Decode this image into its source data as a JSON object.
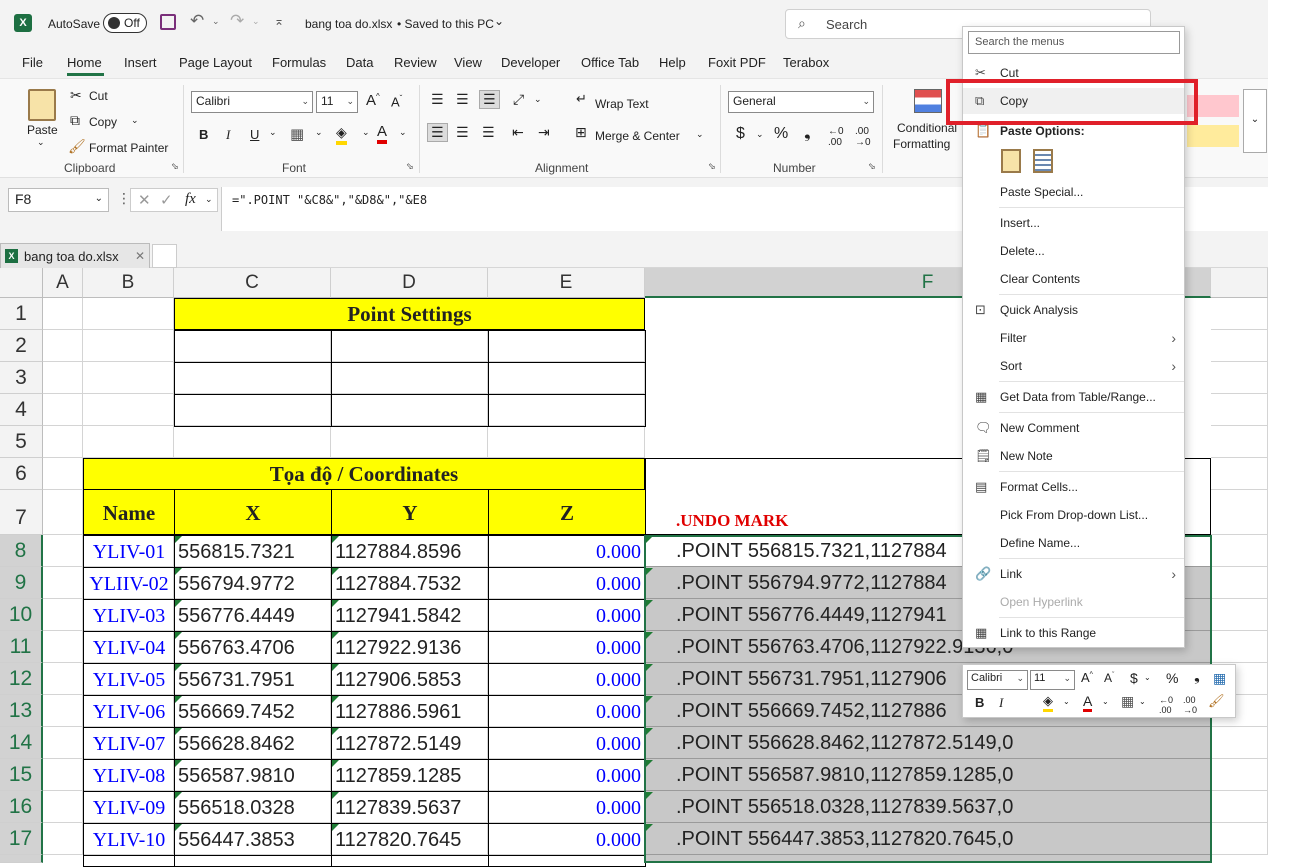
{
  "titlebar": {
    "autosave_label": "AutoSave",
    "toggle_state": "Off",
    "filename": "bang toa do.xlsx",
    "saved_status": "• Saved to this PC",
    "search_placeholder": "Search"
  },
  "menu_tabs": [
    "File",
    "Home",
    "Insert",
    "Page Layout",
    "Formulas",
    "Data",
    "Review",
    "View",
    "Developer",
    "Office Tab",
    "Help",
    "Foxit PDF",
    "Terabox"
  ],
  "ribbon": {
    "clipboard": {
      "paste": "Paste",
      "cut": "Cut",
      "copy": "Copy",
      "format_painter": "Format Painter",
      "label": "Clipboard"
    },
    "font": {
      "name": "Calibri",
      "size": "11",
      "label": "Font",
      "bold": "B",
      "italic": "I",
      "underline": "U"
    },
    "alignment": {
      "wrap": "Wrap Text",
      "merge": "Merge & Center",
      "label": "Alignment"
    },
    "number": {
      "format": "General",
      "currency": "$",
      "percent": "%",
      "label": "Number"
    },
    "styles": {
      "conditional": "Conditional",
      "formatting": "Formatting"
    }
  },
  "formula_bar": {
    "name_box": "F8",
    "fx": "fx",
    "formula": "=\".POINT \"&C8&\",\"&D8&\",\"&E8"
  },
  "workbook_tab": "bang toa do.xlsx",
  "columns": [
    "A",
    "B",
    "C",
    "D",
    "E",
    "F"
  ],
  "rows": [
    "1",
    "2",
    "3",
    "4",
    "5",
    "6",
    "7",
    "8",
    "9",
    "10",
    "11",
    "12",
    "13",
    "14",
    "15",
    "16",
    "17"
  ],
  "sheet": {
    "point_settings": "Point Settings",
    "coordinates_header": "Tọa độ / Coordinates",
    "headers": {
      "name": "Name",
      "x": "X",
      "y": "Y",
      "z": "Z"
    },
    "undo_mark": ".UNDO MARK",
    "data": [
      {
        "name": "YLIV-01",
        "x": "556815.7321",
        "y": "1127884.8596",
        "z": "0.000",
        "f": ".POINT 556815.7321,1127884"
      },
      {
        "name": "YLIIV-02",
        "x": "556794.9772",
        "y": "1127884.7532",
        "z": "0.000",
        "f": ".POINT 556794.9772,1127884"
      },
      {
        "name": "YLIV-03",
        "x": "556776.4449",
        "y": "1127941.5842",
        "z": "0.000",
        "f": ".POINT 556776.4449,1127941"
      },
      {
        "name": "YLIV-04",
        "x": "556763.4706",
        "y": "1127922.9136",
        "z": "0.000",
        "f": ".POINT 556763.4706,1127922.9136,0"
      },
      {
        "name": "YLIV-05",
        "x": "556731.7951",
        "y": "1127906.5853",
        "z": "0.000",
        "f": ".POINT 556731.7951,1127906"
      },
      {
        "name": "YLIV-06",
        "x": "556669.7452",
        "y": "1127886.5961",
        "z": "0.000",
        "f": ".POINT 556669.7452,1127886"
      },
      {
        "name": "YLIV-07",
        "x": "556628.8462",
        "y": "1127872.5149",
        "z": "0.000",
        "f": ".POINT 556628.8462,1127872.5149,0"
      },
      {
        "name": "YLIV-08",
        "x": "556587.9810",
        "y": "1127859.1285",
        "z": "0.000",
        "f": ".POINT 556587.9810,1127859.1285,0"
      },
      {
        "name": "YLIV-09",
        "x": "556518.0328",
        "y": "1127839.5637",
        "z": "0.000",
        "f": ".POINT 556518.0328,1127839.5637,0"
      },
      {
        "name": "YLIV-10",
        "x": "556447.3853",
        "y": "1127820.7645",
        "z": "0.000",
        "f": ".POINT 556447.3853,1127820.7645,0"
      }
    ]
  },
  "context_menu": {
    "search_placeholder": "Search the menus",
    "items": {
      "cut": "Cut",
      "copy": "Copy",
      "paste_options": "Paste Options:",
      "paste_special": "Paste Special...",
      "insert": "Insert...",
      "delete": "Delete...",
      "clear": "Clear Contents",
      "quick_analysis": "Quick Analysis",
      "filter": "Filter",
      "sort": "Sort",
      "get_data": "Get Data from Table/Range...",
      "new_comment": "New Comment",
      "new_note": "New Note",
      "format_cells": "Format Cells...",
      "pick_list": "Pick From Drop-down List...",
      "define_name": "Define Name...",
      "link": "Link",
      "open_hyperlink": "Open Hyperlink",
      "link_range": "Link to this Range"
    }
  },
  "mini_toolbar": {
    "font": "Calibri",
    "size": "11"
  },
  "colors": {
    "yellow": "#ffff00",
    "blue_text": "#0000ff",
    "red_text": "#e00000",
    "highlight_red": "#e0202a",
    "excel_green": "#217346"
  }
}
